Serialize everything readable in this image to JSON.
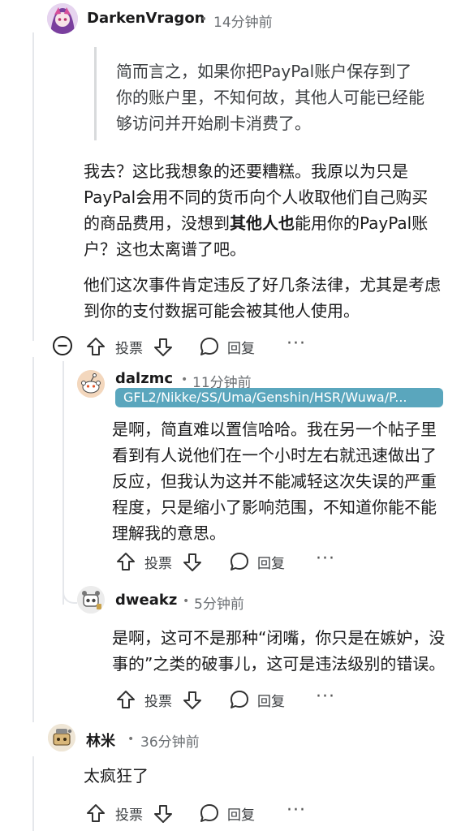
{
  "comments": {
    "c1": {
      "username": "DarkenVragon",
      "time": "14分钟前",
      "quote_lines": [
        "简而言之，如果你把PayPal账户保存到了",
        "你的账户里，不知何故，其他人可能已经能",
        "够访问并开始刷卡消费了。"
      ],
      "p1_lines": [
        "我去？这比我想象的还要糟糕。我原以为只是",
        "PayPal会用不同的货币向个人收取他们自己购买",
        "的商品费用，没想到"
      ],
      "p1_bold": "其他人也",
      "p1_after": "能用你的PayPal账",
      "p1_last": "户？这也太离谱了吧。",
      "p2_lines": [
        "他们这次事件肯定违反了好几条法律，尤其是考虑",
        "到你的支付数据可能会被其他人使用。"
      ],
      "vote_label": "投票",
      "reply_label": "回复",
      "more": "···"
    },
    "c2": {
      "username": "dalzmc",
      "time": "11分钟前",
      "flair": "GFL2/Nikke/SS/Uma/Genshin/HSR/Wuwa/P...",
      "lines": [
        "是啊，简直难以置信哈哈。我在另一个帖子里",
        "看到有人说他们在一个小时左右就迅速做出了",
        "反应，但我认为这并不能减轻这次失误的严重",
        "程度，只是缩小了影响范围，不知道你能不能",
        "理解我的意思。"
      ],
      "vote_label": "投票",
      "reply_label": "回复",
      "more": "···"
    },
    "c3": {
      "username": "dweakz",
      "time": "5分钟前",
      "lines": [
        "是啊，这可不是那种“闭嘴，你只是在嫉妒，没",
        "事的”之类的破事儿，这可是违法级别的错误。"
      ],
      "vote_label": "投票",
      "reply_label": "回复",
      "more": "···"
    },
    "c4": {
      "username": "林米",
      "time": "36分钟前",
      "text": "太疯狂了",
      "vote_label": "投票",
      "reply_label": "回复",
      "more": "···"
    },
    "dot": "•"
  },
  "colors": {
    "flair_bg": "#5aa6bd",
    "thread_line": "#e5e7eb"
  }
}
